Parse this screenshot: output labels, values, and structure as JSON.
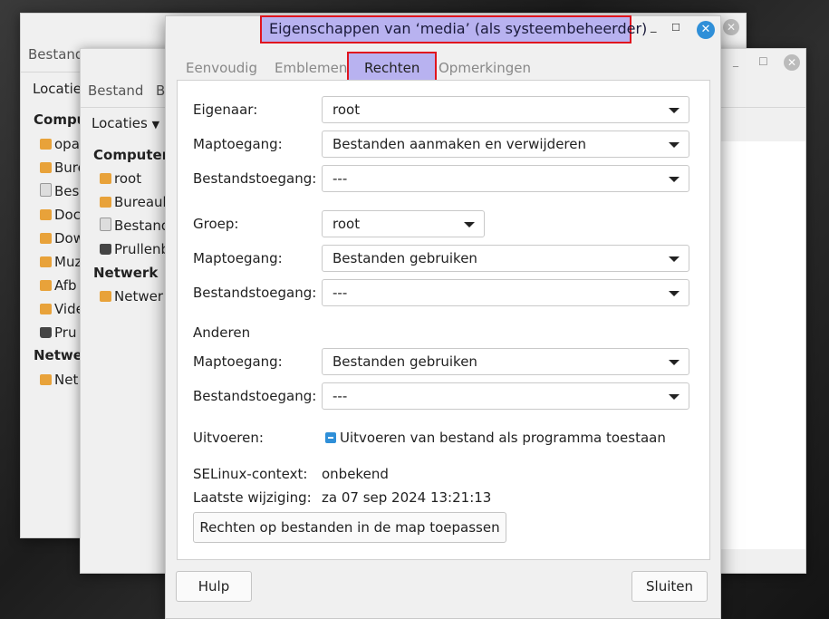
{
  "bg_window_1": {
    "menu_file": "Bestand",
    "locaties": "Locaties",
    "computer_head": "Compu",
    "items": [
      "opa",
      "Bure",
      "Bes",
      "Doc",
      "Dow",
      "Muz",
      "Afb",
      "Vide",
      "Pru"
    ],
    "network_head": "Netwe",
    "network_item": "Net"
  },
  "bg_window_2": {
    "menu_file": "Bestand",
    "menu_b": "B",
    "locaties": "Locaties",
    "computer_head": "Computer",
    "items": [
      "root",
      "Bureaub",
      "Bestand",
      "Prullenb"
    ],
    "network_head": "Netwerk",
    "network_item": "Netwer"
  },
  "dialog": {
    "title": "Eigenschappen van ‘media’ (als systeembeheerder)",
    "tabs": [
      "Eenvoudig",
      "Emblemen",
      "Rechten",
      "Opmerkingen"
    ],
    "active_tab": "Rechten",
    "owner_label": "Eigenaar:",
    "owner_value": "root",
    "owner_folder_label": "Maptoegang:",
    "owner_folder_value": "Bestanden aanmaken en verwijderen",
    "owner_file_label": "Bestandstoegang:",
    "owner_file_value": "---",
    "group_label": "Groep:",
    "group_value": "root",
    "group_folder_label": "Maptoegang:",
    "group_folder_value": "Bestanden gebruiken",
    "group_file_label": "Bestandstoegang:",
    "group_file_value": "---",
    "others_label": "Anderen",
    "others_folder_label": "Maptoegang:",
    "others_folder_value": "Bestanden gebruiken",
    "others_file_label": "Bestandstoegang:",
    "others_file_value": "---",
    "execute_label": "Uitvoeren:",
    "execute_checkbox_label": "Uitvoeren van bestand als programma toestaan",
    "selinux_label": "SELinux-context:",
    "selinux_value": "onbekend",
    "modified_label": "Laatste wijziging:",
    "modified_value": "za 07 sep 2024 13:21:13",
    "apply_button": "Rechten op bestanden in de map toepassen",
    "help_button": "Hulp",
    "close_button": "Sluiten"
  }
}
